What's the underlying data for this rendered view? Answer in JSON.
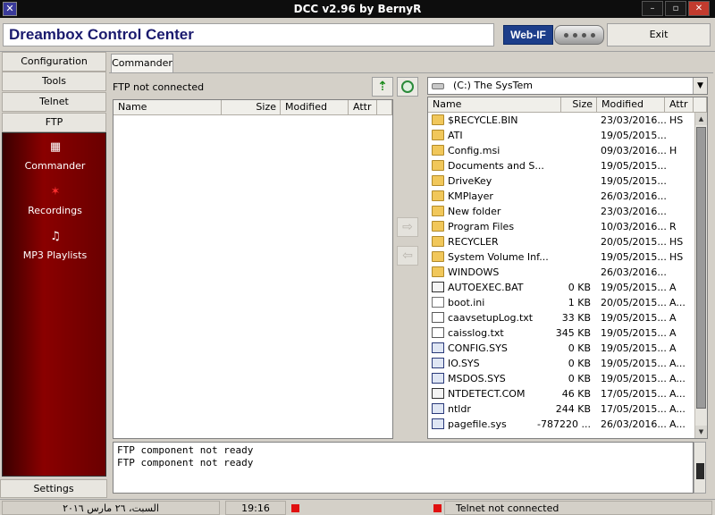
{
  "window": {
    "title": "DCC v2.96 by BernyR",
    "minimize_glyph": "–",
    "maximize_glyph": "▫",
    "close_glyph": "✕"
  },
  "header": {
    "app_name": "Dreambox Control Center",
    "webif_label": "Web-IF",
    "exit_label": "Exit"
  },
  "nav": {
    "buttons": [
      "Configuration",
      "Tools",
      "Telnet",
      "FTP"
    ],
    "items": [
      {
        "label": "Commander",
        "icon": "commander-icon"
      },
      {
        "label": "Recordings",
        "icon": "recordings-icon"
      },
      {
        "label": "MP3 Playlists",
        "icon": "mp3-playlists-icon"
      }
    ],
    "settings_label": "Settings"
  },
  "commander": {
    "tab_label": "Commander",
    "ftp_status": "FTP not connected",
    "ftp_columns": [
      "Name",
      "Size",
      "Modified",
      "Attr"
    ],
    "drive_label": "(C:)  The SysTem",
    "local_columns": [
      "Name",
      "Size",
      "Modified",
      "Attr"
    ],
    "files": [
      {
        "name": "$RECYCLE.BIN",
        "size": "",
        "modified": "23/03/2016...",
        "attr": "HS",
        "type": "folder"
      },
      {
        "name": "ATI",
        "size": "",
        "modified": "19/05/2015...",
        "attr": "",
        "type": "folder"
      },
      {
        "name": "Config.msi",
        "size": "",
        "modified": "09/03/2016...",
        "attr": "H",
        "type": "folder"
      },
      {
        "name": "Documents and S...",
        "size": "",
        "modified": "19/05/2015...",
        "attr": "",
        "type": "folder"
      },
      {
        "name": "DriveKey",
        "size": "",
        "modified": "19/05/2015...",
        "attr": "",
        "type": "folder"
      },
      {
        "name": "KMPlayer",
        "size": "",
        "modified": "26/03/2016...",
        "attr": "",
        "type": "folder"
      },
      {
        "name": "New folder",
        "size": "",
        "modified": "23/03/2016...",
        "attr": "",
        "type": "folder"
      },
      {
        "name": "Program Files",
        "size": "",
        "modified": "10/03/2016...",
        "attr": "R",
        "type": "folder"
      },
      {
        "name": "RECYCLER",
        "size": "",
        "modified": "20/05/2015...",
        "attr": "HS",
        "type": "folder"
      },
      {
        "name": "System Volume Inf...",
        "size": "",
        "modified": "19/05/2015...",
        "attr": "HS",
        "type": "folder"
      },
      {
        "name": "WINDOWS",
        "size": "",
        "modified": "26/03/2016...",
        "attr": "",
        "type": "folder"
      },
      {
        "name": "AUTOEXEC.BAT",
        "size": "0 KB",
        "modified": "19/05/2015...",
        "attr": "A",
        "type": "exec"
      },
      {
        "name": "boot.ini",
        "size": "1 KB",
        "modified": "20/05/2015...",
        "attr": "A...",
        "type": "ini"
      },
      {
        "name": "caavsetupLog.txt",
        "size": "33 KB",
        "modified": "19/05/2015...",
        "attr": "A",
        "type": "file"
      },
      {
        "name": "caisslog.txt",
        "size": "345 KB",
        "modified": "19/05/2015...",
        "attr": "A",
        "type": "file"
      },
      {
        "name": "CONFIG.SYS",
        "size": "0 KB",
        "modified": "19/05/2015...",
        "attr": "A",
        "type": "sys"
      },
      {
        "name": "IO.SYS",
        "size": "0 KB",
        "modified": "19/05/2015...",
        "attr": "A...",
        "type": "sys"
      },
      {
        "name": "MSDOS.SYS",
        "size": "0 KB",
        "modified": "19/05/2015...",
        "attr": "A...",
        "type": "sys"
      },
      {
        "name": "NTDETECT.COM",
        "size": "46 KB",
        "modified": "17/05/2015...",
        "attr": "A...",
        "type": "exec"
      },
      {
        "name": "ntldr",
        "size": "244 KB",
        "modified": "17/05/2015...",
        "attr": "A...",
        "type": "sys"
      },
      {
        "name": "pagefile.sys",
        "size": "-787220 ...",
        "modified": "26/03/2016...",
        "attr": "A...",
        "type": "sys"
      }
    ],
    "log_lines": [
      "FTP component not ready",
      "FTP component not ready"
    ]
  },
  "statusbar": {
    "date": "السبت، ٢٦ مارس ٢٠١٦",
    "time": "19:16",
    "telnet_status": "Telnet not connected",
    "status_color": "#e01010"
  },
  "colors": {
    "brand_text": "#1a1a6e",
    "nav_panel": "#7a0000",
    "titlebar": "#0d0d0d"
  }
}
